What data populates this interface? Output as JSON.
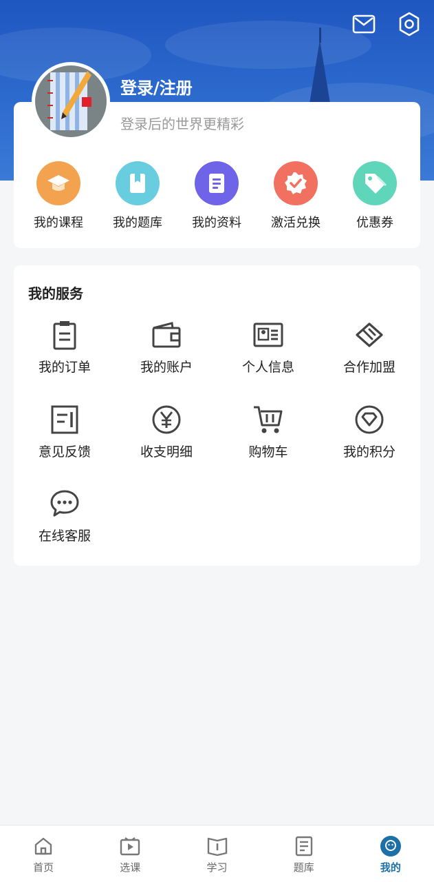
{
  "header": {
    "login_title": "登录/注册",
    "login_subtitle": "登录后的世界更精彩",
    "icons": [
      "mail-icon",
      "settings-icon"
    ]
  },
  "quick_links": [
    {
      "label": "我的课程",
      "icon": "graduation-cap-icon",
      "color": "#f3a24f"
    },
    {
      "label": "我的题库",
      "icon": "question-bank-icon",
      "color": "#69cde0"
    },
    {
      "label": "我的资料",
      "icon": "document-icon",
      "color": "#6f63e8"
    },
    {
      "label": "激活兑换",
      "icon": "badge-check-icon",
      "color": "#f2705f"
    },
    {
      "label": "优惠券",
      "icon": "coupon-tag-icon",
      "color": "#5fd6ba"
    }
  ],
  "services": {
    "title": "我的服务",
    "items": [
      {
        "label": "我的订单",
        "icon": "clipboard-icon"
      },
      {
        "label": "我的账户",
        "icon": "wallet-icon"
      },
      {
        "label": "个人信息",
        "icon": "id-card-icon"
      },
      {
        "label": "合作加盟",
        "icon": "handshake-icon"
      },
      {
        "label": "意见反馈",
        "icon": "feedback-icon"
      },
      {
        "label": "收支明细",
        "icon": "yen-icon"
      },
      {
        "label": "购物车",
        "icon": "cart-icon"
      },
      {
        "label": "我的积分",
        "icon": "diamond-icon"
      },
      {
        "label": "在线客服",
        "icon": "chat-icon"
      }
    ]
  },
  "tabbar": {
    "items": [
      {
        "label": "首页",
        "icon": "home-icon"
      },
      {
        "label": "选课",
        "icon": "video-course-icon"
      },
      {
        "label": "学习",
        "icon": "book-icon"
      },
      {
        "label": "题库",
        "icon": "exam-paper-icon"
      },
      {
        "label": "我的",
        "icon": "profile-face-icon"
      }
    ],
    "active_index": 4,
    "active_color": "#1d6fa8"
  },
  "colors": {
    "hero_blue": "#2a67cc",
    "background": "#f5f6f7"
  }
}
